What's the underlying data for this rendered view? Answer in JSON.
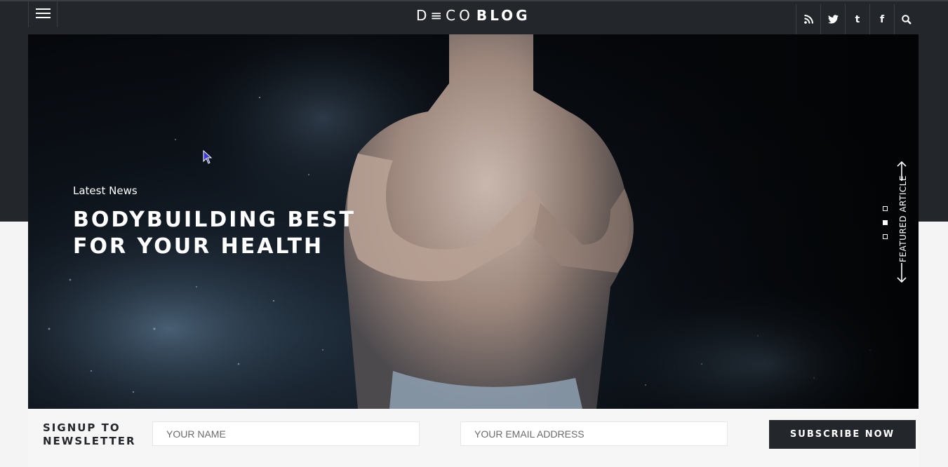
{
  "header": {
    "logo_part1": "D≡CO",
    "logo_part2": "BLOG",
    "menu_icon": "hamburger-menu-icon",
    "social_icons": [
      "rss-icon",
      "twitter-icon",
      "tumblr-icon",
      "facebook-icon",
      "search-icon"
    ],
    "tumblr_glyph": "t",
    "facebook_glyph": "f"
  },
  "hero": {
    "kicker": "Latest News",
    "title": "BODYBUILDING    BEST FOR YOUR HEALTH",
    "side_label": "FEATURED ARTICLE",
    "slide_count": 3,
    "active_slide": 2
  },
  "newsletter": {
    "title": "SIGNUP TO NEWSLETTER",
    "name_placeholder": "YOUR NAME",
    "email_placeholder": "YOUR EMAIL ADDRESS",
    "button_label": "SUBSCRIBE NOW"
  },
  "colors": {
    "header_bg": "#23262a",
    "page_bg": "#f4f4f5",
    "button_bg": "#23262a"
  }
}
